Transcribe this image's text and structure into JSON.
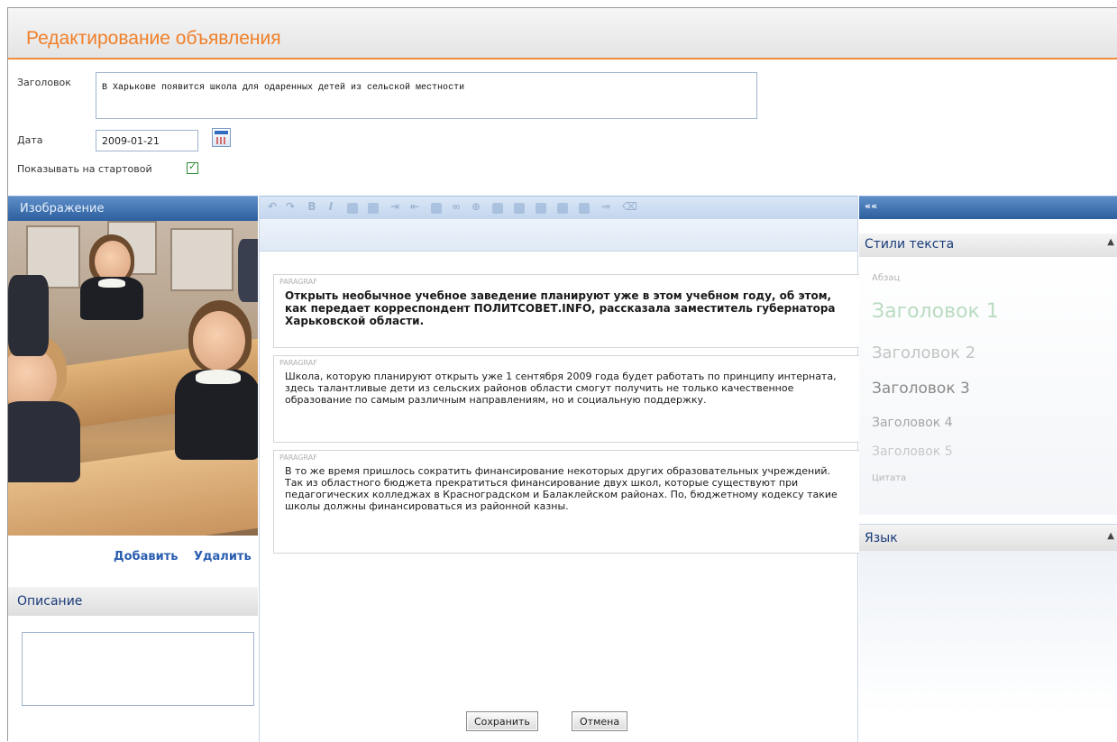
{
  "header": {
    "title": "Редактирование объявления"
  },
  "form": {
    "title_label": "Заголовок",
    "title_value": "В Харькове появится школа для одаренных детей из сельской местности",
    "date_label": "Дата",
    "date_value": "2009-01-21",
    "show_on_start_label": "Показывать на стартовой",
    "show_on_start_checked": true
  },
  "image_panel": {
    "header": "Изображение",
    "add_label": "Добавить",
    "delete_label": "Удалить"
  },
  "description_panel": {
    "header": "Описание",
    "value": ""
  },
  "editor": {
    "toolbar_icons": [
      "undo-icon",
      "redo-icon",
      "bold-icon",
      "italic-icon",
      "bullet-list-icon",
      "numbered-list-icon",
      "indent-icon",
      "outdent-icon",
      "image-icon",
      "link-icon",
      "unlink-icon",
      "table-icon",
      "insert-row-icon",
      "insert-col-icon",
      "delete-row-icon",
      "delete-col-icon",
      "merge-icon",
      "clean-icon"
    ],
    "paragraphs": [
      {
        "tag": "PARAGRAF",
        "text": "Открыть необычное учебное заведение планируют уже в этом учебном году, об этом, как передает корреспондент ПОЛИТСОВЕТ.INFO, рассказала заместитель губернатора Харьковской области.",
        "bold": true
      },
      {
        "tag": "PARAGRAF",
        "text": "Школа, которую планируют открыть уже 1 сентября 2009 года будет работать по принципу интерната, здесь талантливые дети из сельских районов области смогут получить не только качественное образование по самым различным направлениям, но и социальную поддержку.",
        "bold": false
      },
      {
        "tag": "PARAGRAF",
        "text": "В то же время пришлось сократить финансирование некоторых других образовательных учреждений. Так из областного бюджета прекратиться финансирование двух школ, которые существуют при педагогических колледжах в Красноградском и Балаклейском районах. По, бюджетному кодексу такие школы должны финансироваться из районной казны.",
        "bold": false
      }
    ]
  },
  "right_panel": {
    "collapse_label": "««",
    "styles_header": "Стили текста",
    "styles": [
      "Абзац",
      "Заголовок 1",
      "Заголовок 2",
      "Заголовок 3",
      "Заголовок 4",
      "Заголовок 5",
      "Цитата"
    ],
    "language_header": "Язык",
    "toggle_glyph": "▲"
  },
  "buttons": {
    "save": "Сохранить",
    "cancel": "Отмена"
  },
  "colors": {
    "accent": "#f07f29",
    "panel_blue": "#2d5f9f",
    "link": "#2a5eb0"
  }
}
